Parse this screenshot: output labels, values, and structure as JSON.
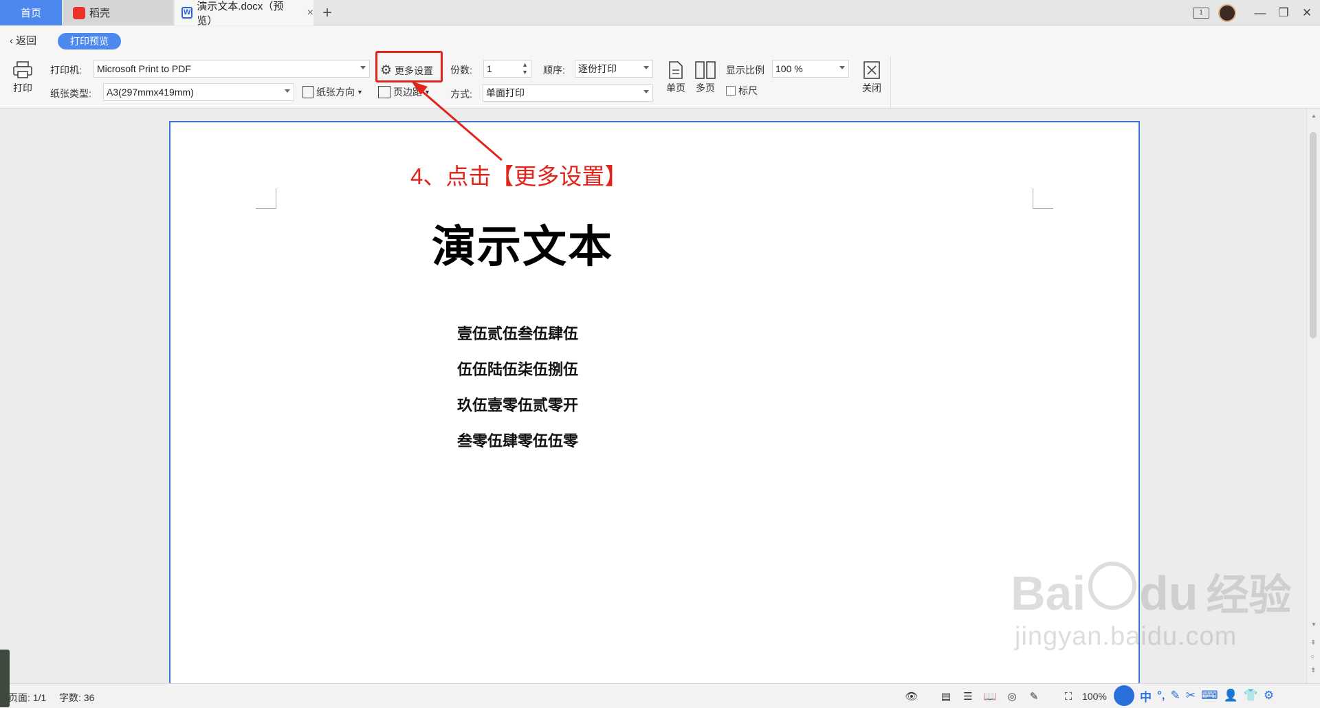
{
  "tabs": {
    "home": "首页",
    "docer": "稻壳",
    "doc": "演示文本.docx（预览）"
  },
  "toolbar": {
    "back": "返回",
    "mode": "打印预览",
    "print": "打印",
    "printer_label": "打印机:",
    "printer_value": "Microsoft Print to PDF",
    "more_settings": "更多设置",
    "copies_label": "份数:",
    "copies_value": "1",
    "order_label": "顺序:",
    "order_value": "逐份打印",
    "single_page": "单页",
    "multi_page": "多页",
    "zoom_label": "显示比例",
    "zoom_value": "100 %",
    "ruler": "标尺",
    "close": "关闭",
    "paper_label": "纸张类型:",
    "paper_value": "A3(297mmx419mm)",
    "orientation": "纸张方向",
    "margins": "页边距",
    "method_label": "方式:",
    "method_value": "单面打印"
  },
  "document": {
    "title": "演示文本",
    "lines": [
      "壹伍贰伍叁伍肆伍",
      "伍伍陆伍柒伍捌伍",
      "玖伍壹零伍贰零开",
      "叁零伍肆零伍伍零"
    ]
  },
  "annotation": "4、点击【更多设置】",
  "status": {
    "page": "页面: 1/1",
    "words": "字数: 36",
    "zoom": "100%"
  },
  "ime": {
    "mode": "中"
  },
  "watermark": {
    "brand": "Bai",
    "brand2": "du",
    "brand3": "经验",
    "url": "jingyan.baidu.com"
  },
  "colors": {
    "accent": "#4d88ee",
    "annotation": "#e2231a",
    "page_border": "#3f72d6"
  }
}
